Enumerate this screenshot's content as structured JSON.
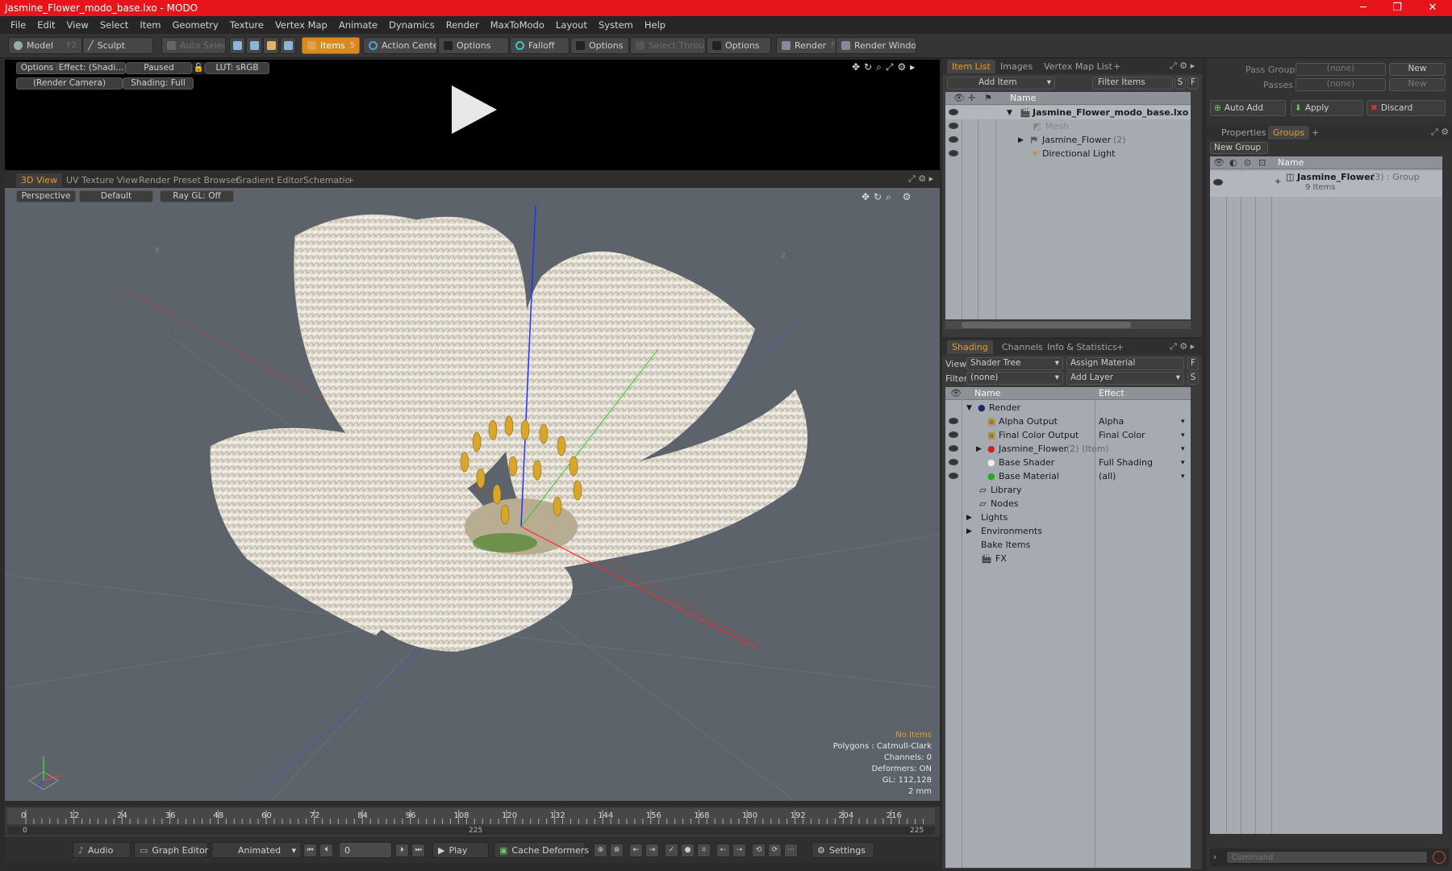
{
  "window": {
    "title": "Jasmine_Flower_modo_base.lxo - MODO",
    "minimize": "─",
    "maximize": "❐",
    "close": "✕"
  },
  "menu": [
    "File",
    "Edit",
    "View",
    "Select",
    "Item",
    "Geometry",
    "Texture",
    "Vertex Map",
    "Animate",
    "Dynamics",
    "Render",
    "MaxToModo",
    "Layout",
    "System",
    "Help"
  ],
  "toolbar": {
    "model": "Model",
    "model_key": "F2",
    "sculpt": "Sculpt",
    "auto_select": "Auto Select",
    "items": "Items",
    "items_key": "5",
    "action_center": "Action Center",
    "options1": "Options",
    "falloff": "Falloff",
    "options2": "Options",
    "select_through": "Select Through",
    "options3": "Options",
    "render": "Render",
    "render_key": "F9",
    "render_window": "Render Window"
  },
  "preview": {
    "options": "Options",
    "effect": "Effect: (Shadi...",
    "paused": "Paused",
    "lut": "LUT: sRGB",
    "camera": "(Render Camera)",
    "shading": "Shading: Full"
  },
  "viewport_tabs": [
    "3D View",
    "UV Texture View",
    "Render Preset Browser",
    "Gradient Editor",
    "Schematic"
  ],
  "viewport": {
    "perspective": "Perspective",
    "default": "Default",
    "raygl": "Ray GL: Off",
    "axis_x": "X",
    "axis_z": "Z",
    "info": {
      "no_items": "No Items",
      "polygons": "Polygons : Catmull-Clark",
      "channels": "Channels: 0",
      "deformers": "Deformers: ON",
      "gl": "GL: 112,128",
      "unit": "2 mm"
    }
  },
  "timeline": {
    "ticks": [
      "0",
      "12",
      "24",
      "36",
      "48",
      "60",
      "72",
      "84",
      "96",
      "108",
      "120",
      "132",
      "144",
      "156",
      "168",
      "180",
      "192",
      "204",
      "216"
    ],
    "start": "0",
    "mid": "225",
    "end": "225"
  },
  "bottombar": {
    "audio": "Audio",
    "graph_editor": "Graph Editor",
    "animated": "Animated",
    "frame": "0",
    "play": "Play",
    "cache_deformers": "Cache Deformers",
    "settings": "Settings"
  },
  "item_list": {
    "tabs": [
      "Item List",
      "Images",
      "Vertex Map List"
    ],
    "add_item": "Add Item",
    "filter_items": "Filter Items",
    "btn_s": "S",
    "btn_f": "F",
    "col_name": "Name",
    "rows": [
      {
        "label": "Jasmine_Flower_modo_base.lxo",
        "extra": ""
      },
      {
        "label": "Mesh",
        "extra": ""
      },
      {
        "label": "Jasmine_Flower",
        "extra": "(2)"
      },
      {
        "label": "Directional Light",
        "extra": ""
      }
    ]
  },
  "shading": {
    "tabs": [
      "Shading",
      "Channels",
      "Info & Statistics"
    ],
    "view_label": "View",
    "view_value": "Shader Tree",
    "assign_material": "Assign Material",
    "filter_label": "Filter",
    "filter_value": "(none)",
    "add_layer": "Add Layer",
    "btn_f": "F",
    "btn_s": "S",
    "col_name": "Name",
    "col_effect": "Effect",
    "rows": [
      {
        "label": "Render",
        "extra": "",
        "effect": ""
      },
      {
        "label": "Alpha Output",
        "extra": "",
        "effect": "Alpha"
      },
      {
        "label": "Final Color Output",
        "extra": "",
        "effect": "Final Color"
      },
      {
        "label": "Jasmine_Flower",
        "extra": "(2) (Item)",
        "effect": ""
      },
      {
        "label": "Base Shader",
        "extra": "",
        "effect": "Full Shading"
      },
      {
        "label": "Base Material",
        "extra": "",
        "effect": "(all)"
      },
      {
        "label": "Library",
        "extra": "",
        "effect": ""
      },
      {
        "label": "Nodes",
        "extra": "",
        "effect": ""
      },
      {
        "label": "Lights",
        "extra": "",
        "effect": ""
      },
      {
        "label": "Environments",
        "extra": "",
        "effect": ""
      },
      {
        "label": "Bake Items",
        "extra": "",
        "effect": ""
      },
      {
        "label": "FX",
        "extra": "",
        "effect": ""
      }
    ]
  },
  "groups": {
    "pass_groups_label": "Pass Groups",
    "pass_groups_value": "(none)",
    "new": "New",
    "passes_label": "Passes",
    "passes_value": "(none)",
    "new2": "New",
    "auto_add": "Auto Add",
    "apply": "Apply",
    "discard": "Discard",
    "tabs": [
      "Properties",
      "Groups"
    ],
    "new_group": "New Group",
    "col_name": "Name",
    "group_name": "Jasmine_Flower",
    "group_extra": "(3) : Group",
    "group_items": "9 Items"
  },
  "command": {
    "placeholder": "Command"
  },
  "colors": {
    "accent": "#e89a2c",
    "titlebar": "#e8141c",
    "viewport_bg": "#5c636b",
    "panel_light": "#a6abb2"
  }
}
